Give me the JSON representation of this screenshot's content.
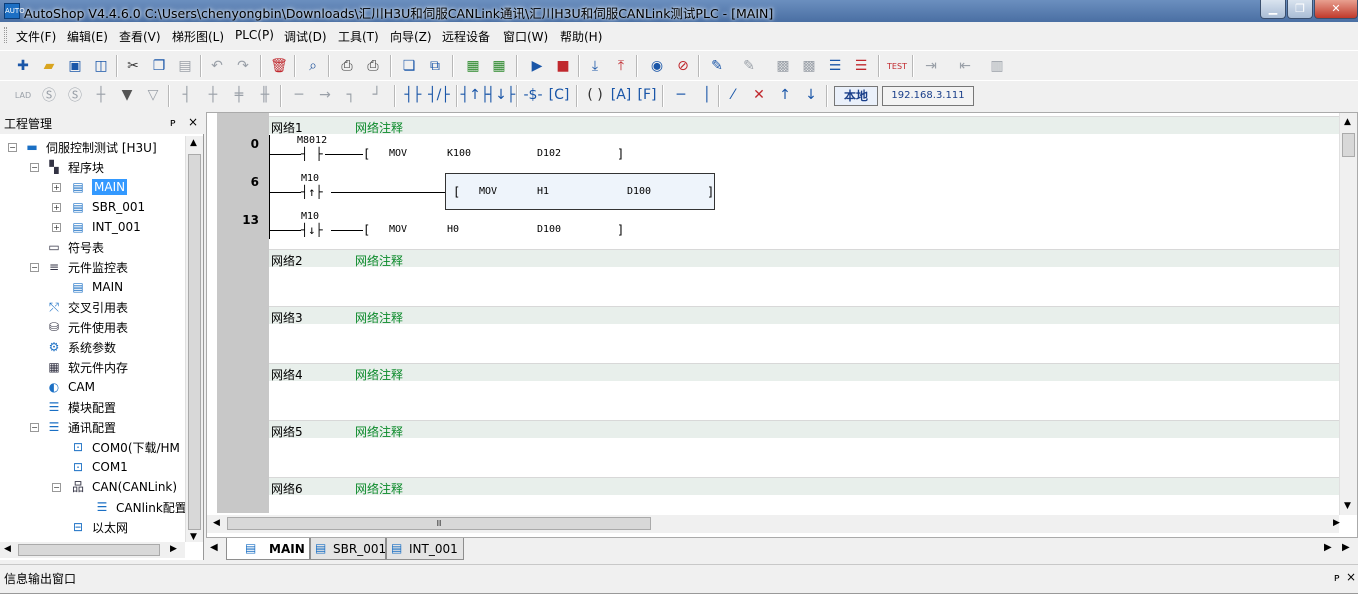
{
  "window": {
    "title": "AutoShop V4.4.6.0  C:\\Users\\chenyongbin\\Downloads\\汇川H3U和伺服CANLink通讯\\汇川H3U和伺服CANLink测试PLC - [MAIN]"
  },
  "menu": {
    "items": [
      "文件(F)",
      "编辑(E)",
      "查看(V)",
      "梯形图(L)",
      "PLC(P)",
      "调试(D)",
      "工具(T)",
      "向导(Z)",
      "远程设备",
      "窗口(W)",
      "帮助(H)"
    ]
  },
  "toolbar2": {
    "location_label": "本地",
    "ip_address": "192.168.3.111"
  },
  "project": {
    "pane_title": "工程管理",
    "pin": "ᴘ",
    "close": "×",
    "root": "伺服控制测试 [H3U]",
    "items": [
      {
        "label": "程序块"
      },
      {
        "label": "MAIN"
      },
      {
        "label": "SBR_001"
      },
      {
        "label": "INT_001"
      },
      {
        "label": "符号表"
      },
      {
        "label": "元件监控表"
      },
      {
        "label": "MAIN"
      },
      {
        "label": "交叉引用表"
      },
      {
        "label": "元件使用表"
      },
      {
        "label": "系统参数"
      },
      {
        "label": "软元件内存"
      },
      {
        "label": "CAM"
      },
      {
        "label": "模块配置"
      },
      {
        "label": "通讯配置"
      },
      {
        "label": "COM0(下载/HM"
      },
      {
        "label": "COM1"
      },
      {
        "label": "CAN(CANLink)"
      },
      {
        "label": "CANlink配置"
      },
      {
        "label": "以太网"
      }
    ]
  },
  "ladder": {
    "networks": [
      {
        "name": "网络1",
        "comment": "网络注释"
      },
      {
        "name": "网络2",
        "comment": "网络注释"
      },
      {
        "name": "网络3",
        "comment": "网络注释"
      },
      {
        "name": "网络4",
        "comment": "网络注释"
      },
      {
        "name": "网络5",
        "comment": "网络注释"
      },
      {
        "name": "网络6",
        "comment": "网络注释"
      }
    ],
    "rungs": [
      {
        "step": "0",
        "contact": "M8012",
        "instr": "MOV",
        "src": "K100",
        "dst": "D102"
      },
      {
        "step": "6",
        "contact": "M10",
        "instr": "MOV",
        "src": "H1",
        "dst": "D100"
      },
      {
        "step": "13",
        "contact": "M10",
        "instr": "MOV",
        "src": "H0",
        "dst": "D100"
      }
    ]
  },
  "tabs": [
    {
      "label": "MAIN",
      "active": true
    },
    {
      "label": "SBR_001",
      "active": false
    },
    {
      "label": "INT_001",
      "active": false
    }
  ],
  "info": {
    "title": "信息输出窗口"
  },
  "scroll": {
    "grip": "Ⅲ"
  }
}
